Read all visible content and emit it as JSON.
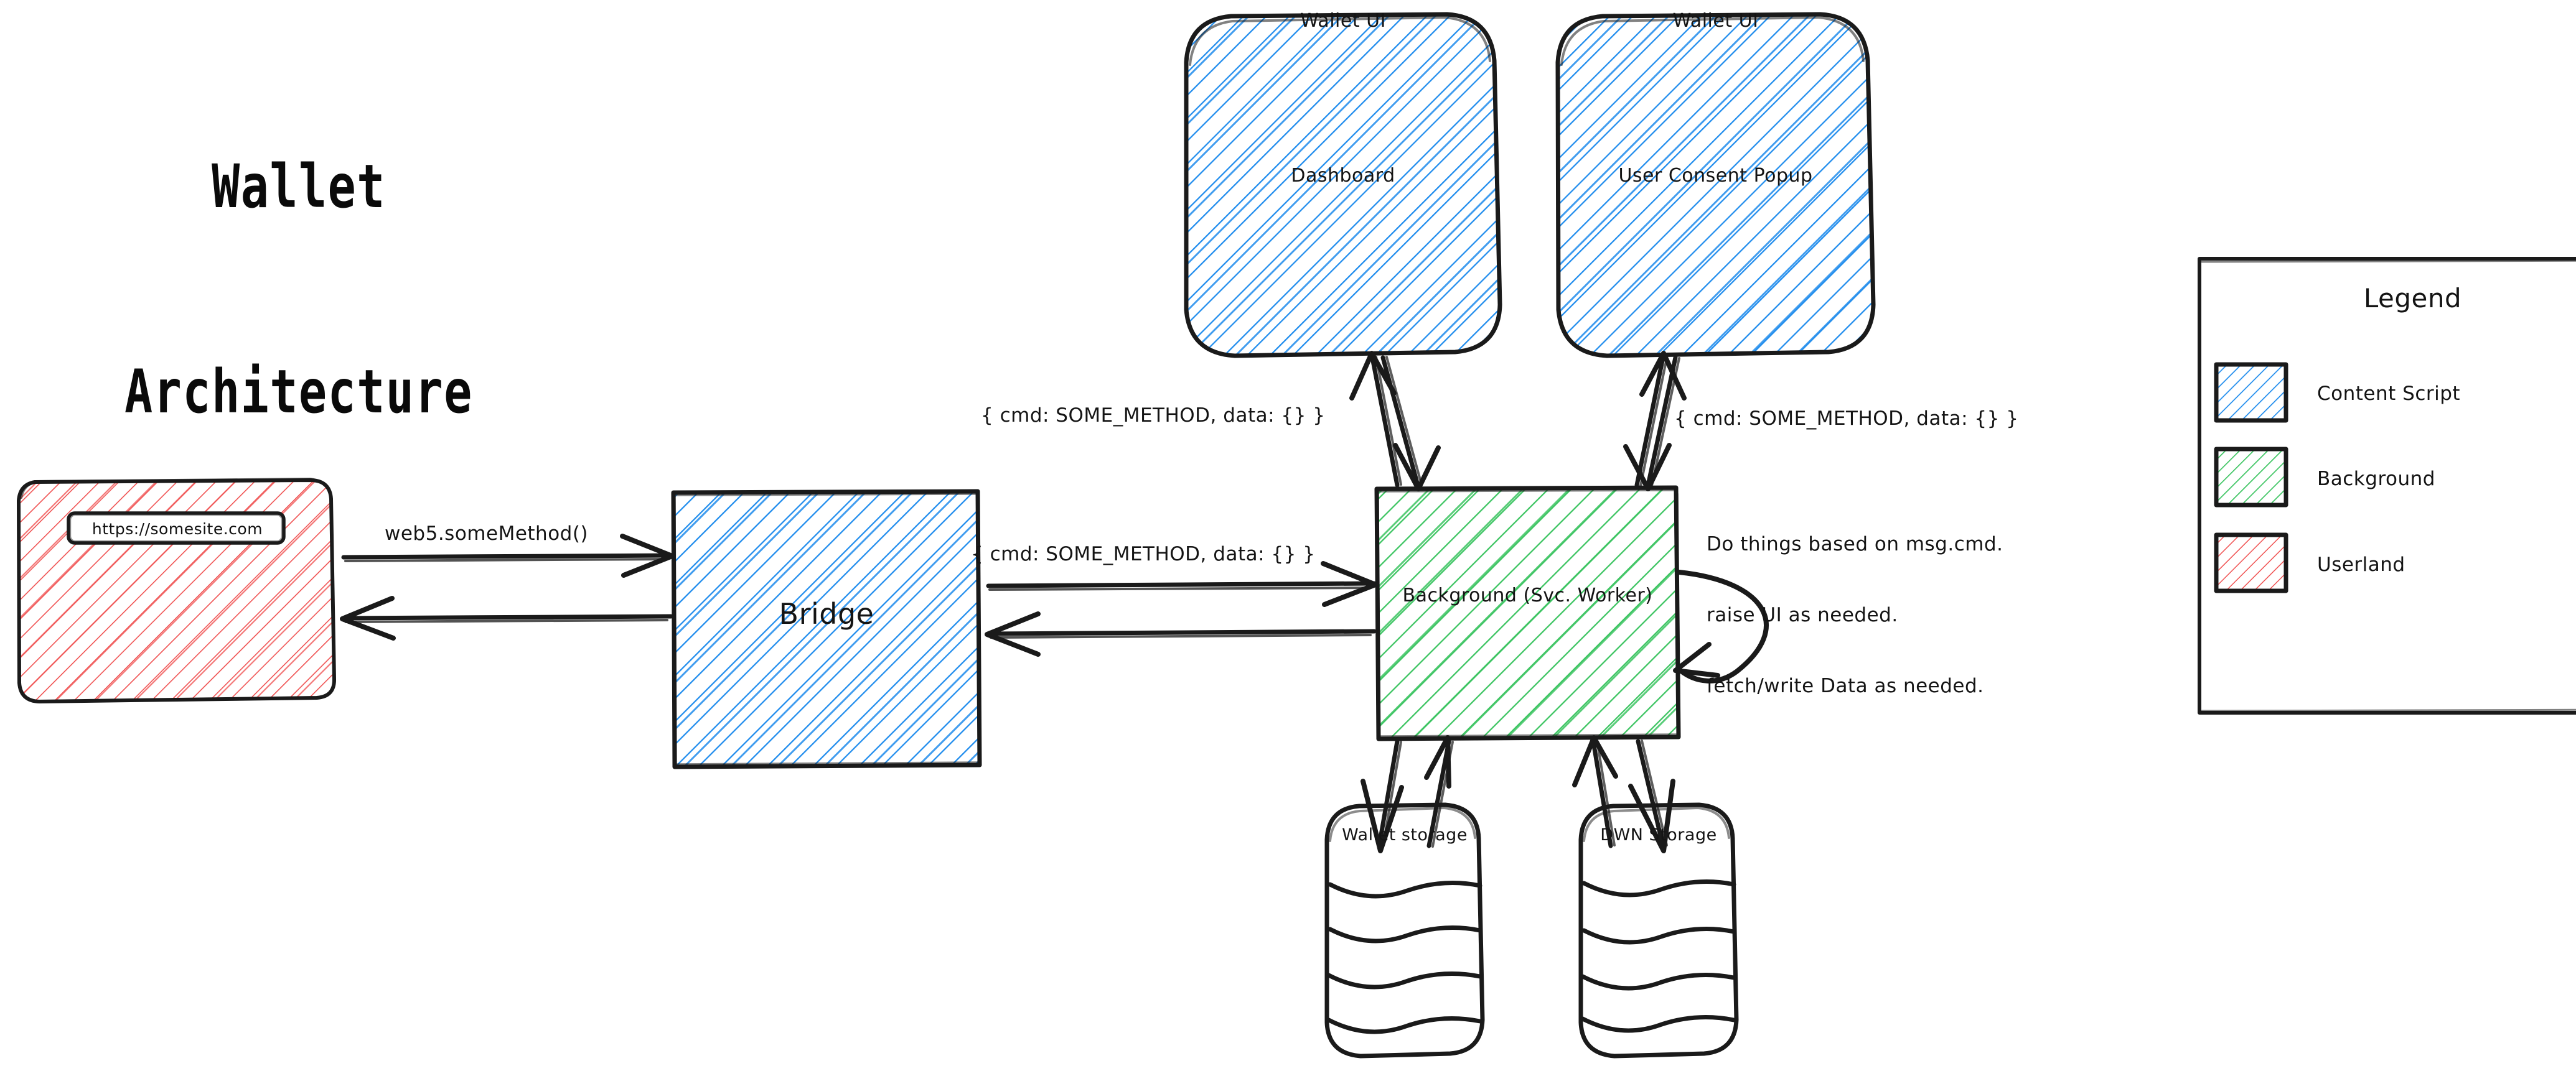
{
  "title": {
    "line1": "Wallet",
    "line2": "Architecture"
  },
  "nodes": {
    "userland": {
      "url_pill": "https://somesite.com",
      "kind": "Userland"
    },
    "bridge": {
      "label": "Bridge",
      "kind": "Content Script"
    },
    "dashboard": {
      "label_top": "Wallet UI",
      "label_main": "Dashboard",
      "kind": "Content Script"
    },
    "consent_popup": {
      "label_top": "Wallet UI",
      "label_main": "User Consent Popup",
      "kind": "Content Script"
    },
    "background": {
      "label": "Background (Svc. Worker)",
      "kind": "Background"
    },
    "wallet_storage": {
      "label": "Wallet storage"
    },
    "dwn_storage": {
      "label": "DWN Storage"
    }
  },
  "edges": {
    "userland_to_bridge": "web5.someMethod()",
    "bridge_to_background": "{ cmd: SOME_METHOD, data: {} }",
    "background_to_dashboard": "{ cmd: SOME_METHOD, data: {} }",
    "background_to_consent": "{ cmd: SOME_METHOD, data: {} }"
  },
  "notes": {
    "background_behavior": [
      "Do things based on msg.cmd.",
      "raise UI as needed.",
      "fetch/write Data as needed."
    ]
  },
  "legend": {
    "title": "Legend",
    "items": [
      {
        "label": "Content Script",
        "color": "#1f8ced"
      },
      {
        "label": "Background",
        "color": "#3cc461"
      },
      {
        "label": "Userland",
        "color": "#f05252"
      }
    ]
  },
  "colors": {
    "content_script": "#1f8ced",
    "background": "#3cc461",
    "userland": "#f05252",
    "stroke": "#1a1a1a",
    "canvas": "#ffffff"
  }
}
